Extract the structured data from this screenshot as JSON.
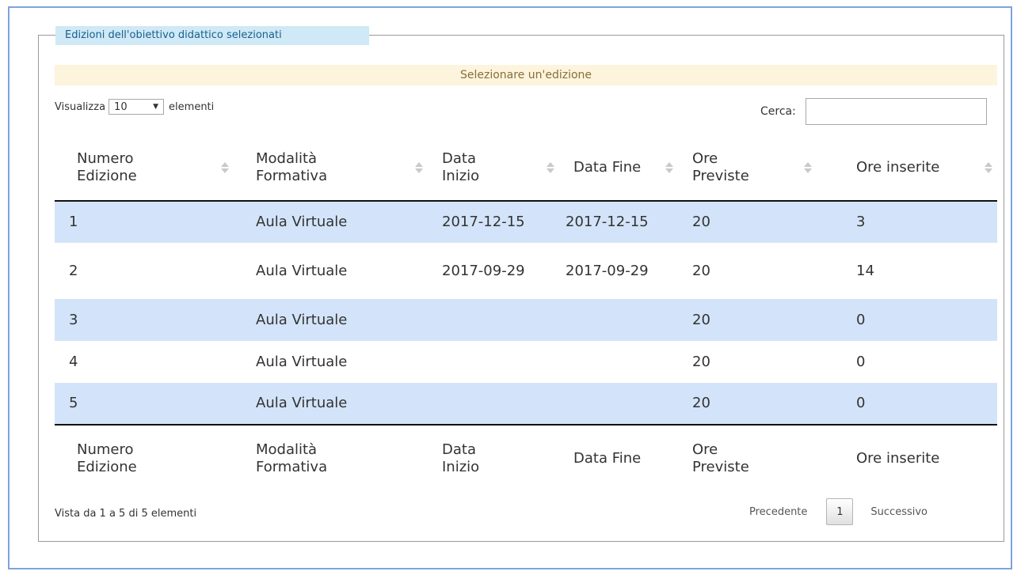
{
  "fieldset": {
    "legend": "Edizioni dell'obiettivo didattico selezionati"
  },
  "banner": "Selezionare un'edizione",
  "length": {
    "prefix": "Visualizza",
    "value": "10",
    "suffix": "elementi"
  },
  "search": {
    "label": "Cerca:",
    "value": ""
  },
  "table": {
    "headers": [
      [
        "Numero",
        "Edizione"
      ],
      [
        "Modalità",
        "Formativa"
      ],
      [
        "Data",
        "Inizio"
      ],
      [
        "Data Fine"
      ],
      [
        "Ore",
        "Previste"
      ],
      [
        "Ore inserite"
      ]
    ],
    "rows": [
      [
        "1",
        "Aula Virtuale",
        "2017-12-15",
        "2017-12-15",
        "20",
        "3"
      ],
      [
        "2",
        "Aula Virtuale",
        "2017-09-29",
        "2017-09-29",
        "20",
        "14"
      ],
      [
        "3",
        "Aula Virtuale",
        "",
        "",
        "20",
        "0"
      ],
      [
        "4",
        "Aula Virtuale",
        "",
        "",
        "20",
        "0"
      ],
      [
        "5",
        "Aula Virtuale",
        "",
        "",
        "20",
        "0"
      ]
    ]
  },
  "info": "Vista da 1 a 5 di 5 elementi",
  "pagination": {
    "previous": "Precedente",
    "page": "1",
    "next": "Successivo"
  },
  "colors": {
    "row_highlight": "#d3e4fa",
    "banner_bg": "#fcf4dc",
    "legend_bg": "#cfe9f6",
    "frame": "#7fa2e0"
  }
}
